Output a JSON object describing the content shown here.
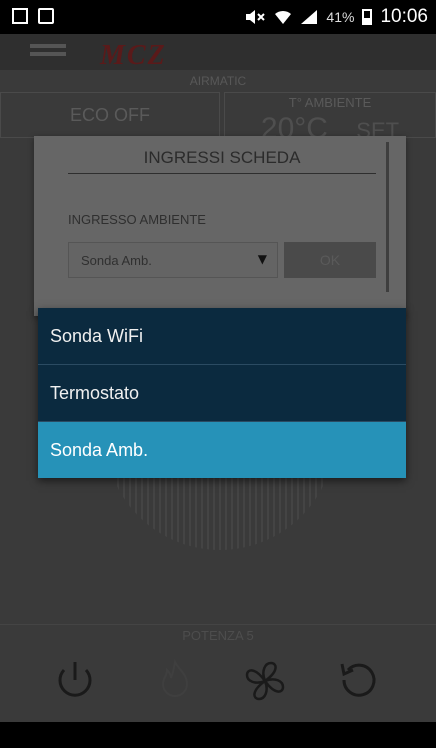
{
  "status_bar": {
    "battery_percent": "41%",
    "time": "10:06",
    "icons": [
      "image-icon",
      "clipboard-icon",
      "mute-icon",
      "wifi-icon",
      "signal-icon",
      "battery-icon"
    ]
  },
  "app": {
    "logo_text": "MCZ",
    "section_label": "AIRMATIC",
    "eco_label": "ECO OFF",
    "ambient_label": "T° AMBIENTE",
    "ambient_value": "20°C",
    "set_label": "SET",
    "power_label": "POTENZA 5"
  },
  "dialog": {
    "title": "INGRESSI SCHEDA",
    "field_label": "INGRESSO AMBIENTE",
    "select_value": "Sonda Amb.",
    "ok_label": "OK"
  },
  "dropdown": {
    "options": [
      "Sonda WiFi",
      "Termostato",
      "Sonda Amb."
    ],
    "selected_index": 2
  },
  "colors": {
    "dropdown_bg": "#0b2a3f",
    "dropdown_selected": "#2692b8"
  }
}
